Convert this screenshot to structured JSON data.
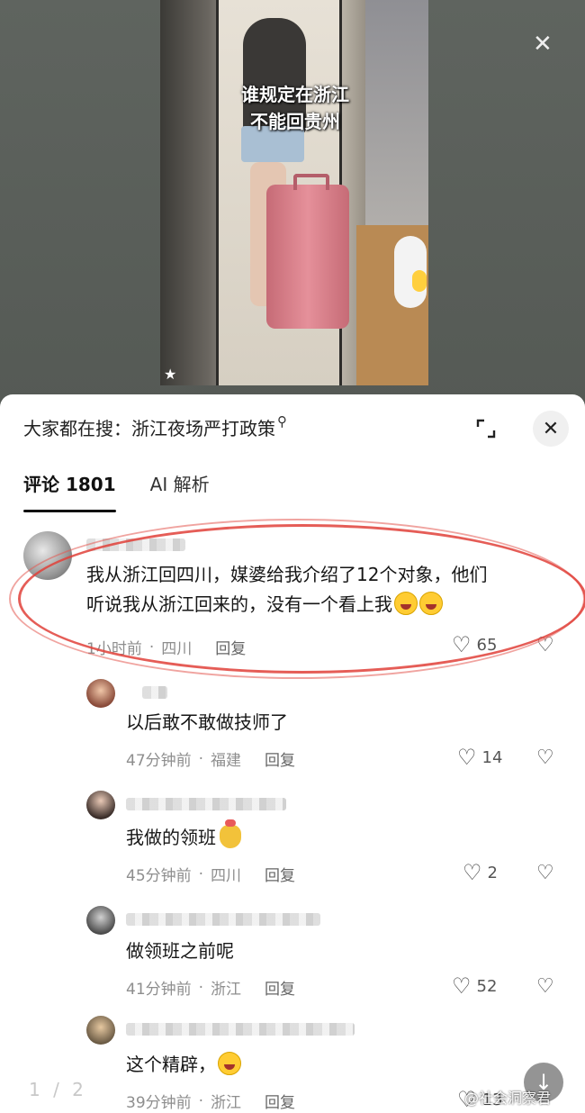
{
  "video": {
    "overlay_line1": "谁规定在浙江",
    "overlay_line2": "不能回贵州"
  },
  "sheet": {
    "search_label": "大家都在搜：浙江夜场严打政策",
    "tabs": [
      {
        "label": "评论 1801"
      },
      {
        "label": "AI 解析"
      }
    ]
  },
  "comments": [
    {
      "text_line1": "我从浙江回四川，媒婆给我介绍了12个对象，他们",
      "text_line2": "听说我从浙江回来的，没有一个看上我",
      "time": "1小时前",
      "location": "四川",
      "reply": "回复",
      "likes": "65"
    },
    {
      "text": "以后敢不敢做技师了",
      "time": "47分钟前",
      "location": "福建",
      "reply": "回复",
      "likes": "14"
    },
    {
      "text": "我做的领班",
      "time": "45分钟前",
      "location": "四川",
      "reply": "回复",
      "likes": "2"
    },
    {
      "text": "做领班之前呢",
      "time": "41分钟前",
      "location": "浙江",
      "reply": "回复",
      "likes": "52"
    },
    {
      "text": "这个精辟，",
      "time": "39分钟前",
      "location": "浙江",
      "reply": "回复",
      "likes": "13"
    }
  ],
  "footer": {
    "pager": "1 / 2",
    "watermark": "@社会洞察君"
  },
  "icons": {
    "expand": "expand-icon",
    "close": "close-icon",
    "heart": "heart-icon",
    "dislike": "broken-heart-icon"
  }
}
